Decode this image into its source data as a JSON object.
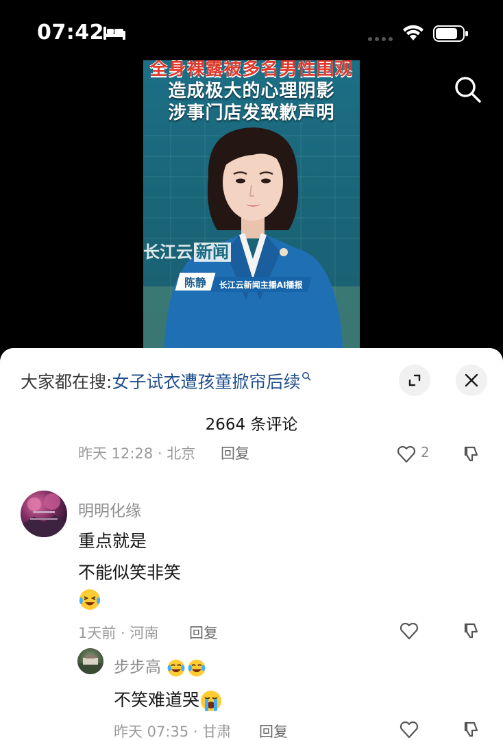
{
  "status_bar": {
    "time": "07:42",
    "icons": [
      "sleep-focus-icon",
      "signal-icon",
      "wifi-icon",
      "battery-icon"
    ]
  },
  "video": {
    "headline_lines": [
      "全身裸露被多名男性围观",
      "造成极大的心理阴影",
      "涉事门店发致歉声明"
    ],
    "watermark_prefix": "长江云",
    "watermark_box": "新闻",
    "anchor_name": "陈静",
    "anchor_role": "长江云新闻主播AI播报"
  },
  "comments_panel": {
    "trending_label": "大家都在搜:",
    "trending_query": "女子试衣遭孩童掀帘后续",
    "comment_count": "2664 条评论",
    "partial_row": {
      "meta": "昨天 12:28 · 北京",
      "reply": "回复",
      "likes": "2"
    },
    "comments": [
      {
        "username": "明明化缘",
        "lines": [
          "重点就是",
          "不能似笑非笑"
        ],
        "emoji": "laughing-crying-emoji",
        "meta": "1天前 · 河南",
        "reply": "回复"
      }
    ],
    "reply": {
      "username": "步步高",
      "username_emojis": [
        "tears-of-joy-emoji",
        "tears-of-joy-emoji"
      ],
      "text": "不笑难道哭",
      "text_emoji": "loudly-crying-emoji",
      "meta": "昨天 07:35 · 甘肃",
      "reply": "回复"
    }
  }
}
